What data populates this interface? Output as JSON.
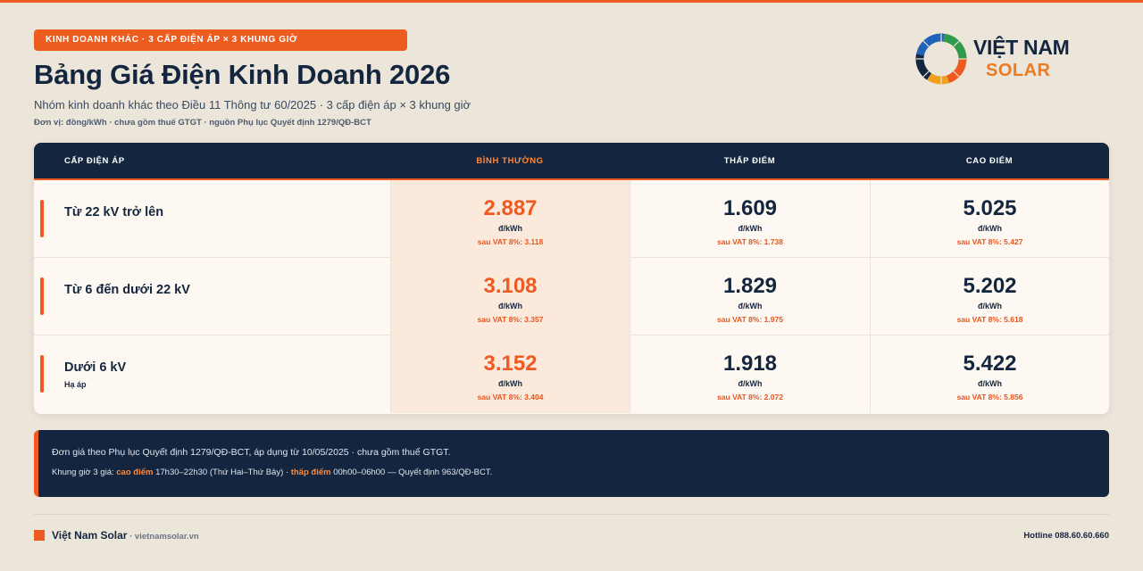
{
  "header": {
    "badge": "Kinh doanh khác · 3 cấp điện áp × 3 khung giờ",
    "title": "Bảng Giá Điện Kinh Doanh 2026",
    "subtitle": "Nhóm kinh doanh khác theo Điều 11 Thông tư 60/2025 · 3 cấp điện áp × 3 khung giờ",
    "unit_note": "Đơn vị: đồng/kWh · chưa gồm thuế GTGT · nguồn Phụ lục Quyết định 1279/QĐ-BCT"
  },
  "logo": {
    "line1": "VIỆT NAM",
    "line2": "SOLAR",
    "icon": "solar-ring-logo-icon",
    "colors": [
      "#ee5a20",
      "#f0a020",
      "#2e9a4a",
      "#1e63b8",
      "#14263f"
    ]
  },
  "table": {
    "headers": [
      "Cấp điện áp",
      "Bình thường",
      "Thấp điểm",
      "Cao điểm"
    ],
    "unit": "đ/kWh",
    "rows": [
      {
        "label": "Từ 22 kV trở lên",
        "sub": "",
        "cells": [
          {
            "price": "2.887",
            "vat": "sau VAT 8%: 3.118"
          },
          {
            "price": "1.609",
            "vat": "sau VAT 8%: 1.738"
          },
          {
            "price": "5.025",
            "vat": "sau VAT 8%: 5.427"
          }
        ]
      },
      {
        "label": "Từ 6 đến dưới 22 kV",
        "sub": "",
        "cells": [
          {
            "price": "3.108",
            "vat": "sau VAT 8%: 3.357"
          },
          {
            "price": "1.829",
            "vat": "sau VAT 8%: 1.975"
          },
          {
            "price": "5.202",
            "vat": "sau VAT 8%: 5.618"
          }
        ]
      },
      {
        "label": "Dưới 6 kV",
        "sub": "Hạ áp",
        "cells": [
          {
            "price": "3.152",
            "vat": "sau VAT 8%: 3.404"
          },
          {
            "price": "1.918",
            "vat": "sau VAT 8%: 2.072"
          },
          {
            "price": "5.422",
            "vat": "sau VAT 8%: 5.856"
          }
        ]
      }
    ]
  },
  "notes": {
    "line1": "Đơn giá theo Phụ lục Quyết định 1279/QĐ-BCT, áp dụng từ 10/05/2025 · chưa gồm thuế GTGT.",
    "line2_prefix": "Khung giờ 3 giá: ",
    "peak_label": "cao điểm",
    "peak_time": " 17h30–22h30 (Thứ Hai–Thứ Bảy) · ",
    "offpeak_label": "thấp điểm",
    "offpeak_time": " 00h00–06h00 — Quyết định 963/QĐ-BCT."
  },
  "footer": {
    "brand": "Việt Nam Solar",
    "site": " · vietnamsolar.vn",
    "hotline": "Hotline 088.60.60.660"
  },
  "colors": {
    "accent": "#ee5a20",
    "navy": "#14263f",
    "highlight_column": "#fbeadc",
    "background": "#ece5d9"
  }
}
